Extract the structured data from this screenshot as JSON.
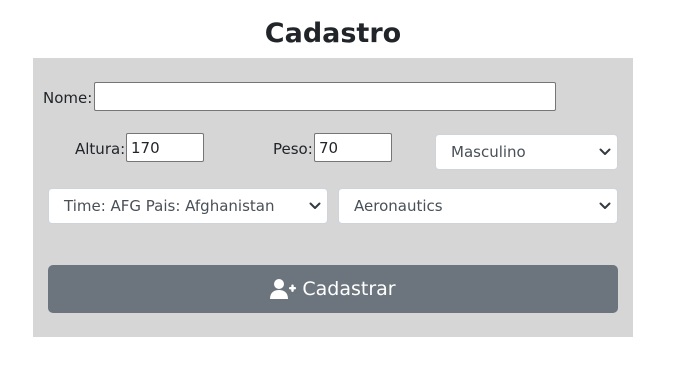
{
  "form": {
    "title": "Cadastro",
    "nome_label": "Nome:",
    "nome_value": "",
    "altura_label": "Altura:",
    "altura_value": "170",
    "peso_label": "Peso:",
    "peso_value": "70",
    "sexo_selected": "Masculino",
    "time_selected": "Time: AFG Pais: Afghanistan",
    "esporte_selected": "Aeronautics",
    "submit_label": "Cadastrar",
    "submit_icon": "user-plus-icon"
  }
}
